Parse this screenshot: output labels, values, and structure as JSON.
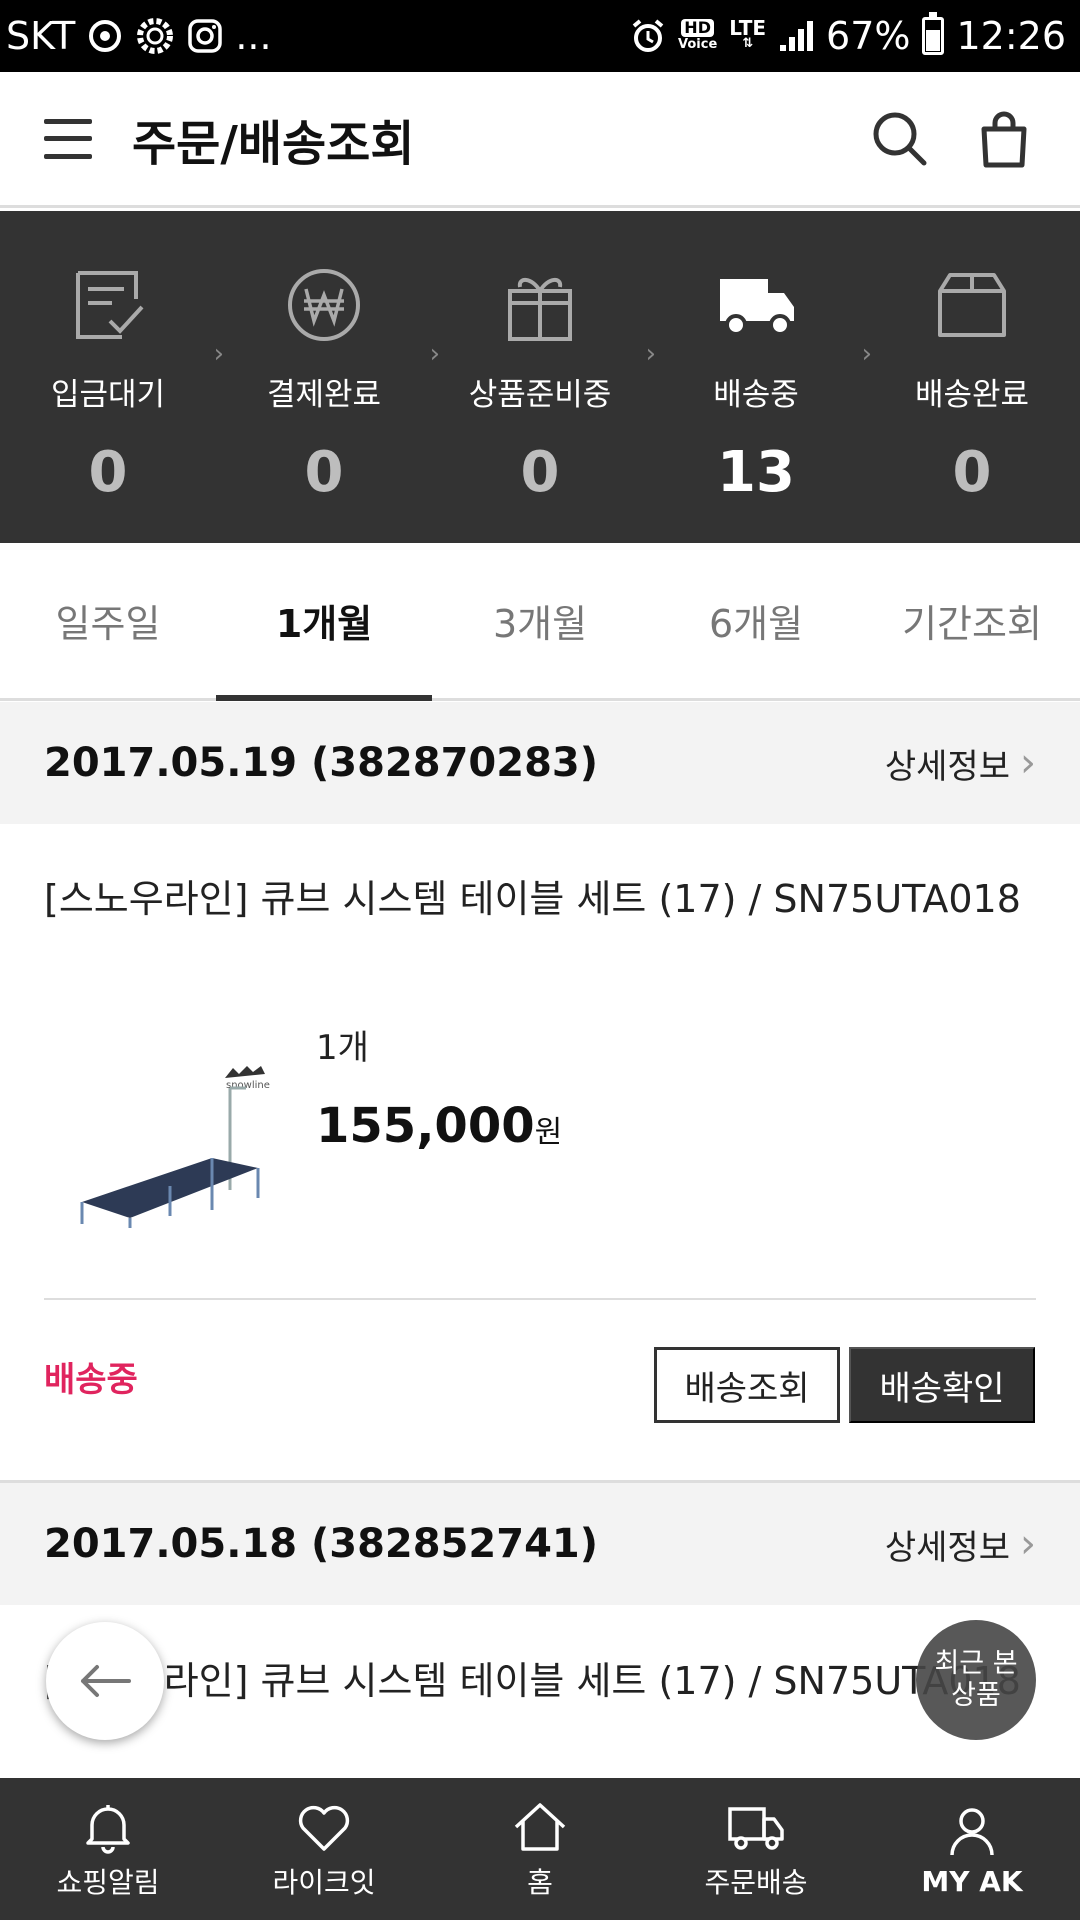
{
  "status_bar": {
    "carrier": "SKT",
    "dots": "...",
    "hd_top": "HD",
    "hd_bottom": "Voice",
    "network": "LTE",
    "battery": "67%",
    "time": "12:26"
  },
  "header": {
    "title": "주문/배송조회"
  },
  "summary": [
    {
      "label": "입금대기",
      "count": "0"
    },
    {
      "label": "결제완료",
      "count": "0"
    },
    {
      "label": "상품준비중",
      "count": "0"
    },
    {
      "label": "배송중",
      "count": "13"
    },
    {
      "label": "배송완료",
      "count": "0"
    }
  ],
  "tabs": [
    {
      "label": "일주일"
    },
    {
      "label": "1개월",
      "active": true
    },
    {
      "label": "3개월"
    },
    {
      "label": "6개월"
    },
    {
      "label": "기간조회"
    }
  ],
  "orders": [
    {
      "date": "2017.05.19 (382870283)",
      "detail_label": "상세정보",
      "product_name": "[스노우라인] 큐브 시스템 테이블 세트 (17) / SN75UTA018",
      "image_brand": "snowline",
      "quantity": "1개",
      "price": "155,000",
      "currency": "원",
      "status": "배송중",
      "track_button": "배송조회",
      "confirm_button": "배송확인"
    },
    {
      "date": "2017.05.18 (382852741)",
      "detail_label": "상세정보",
      "product_name": "[스노우라인] 큐브 시스템 테이블 세트 (17) / SN75UTA018"
    }
  ],
  "floating": {
    "recent_line1": "최근 본",
    "recent_line2": "상품"
  },
  "bottom_nav": [
    {
      "label": "쇼핑알림",
      "icon": "bell-icon"
    },
    {
      "label": "라이크잇",
      "icon": "heart-icon"
    },
    {
      "label": "홈",
      "icon": "home-icon"
    },
    {
      "label": "주문배송",
      "icon": "truck-icon"
    },
    {
      "label": "MY AK",
      "icon": "person-icon"
    }
  ],
  "colors": {
    "dark": "#333333",
    "accent_red": "#e0245e"
  }
}
